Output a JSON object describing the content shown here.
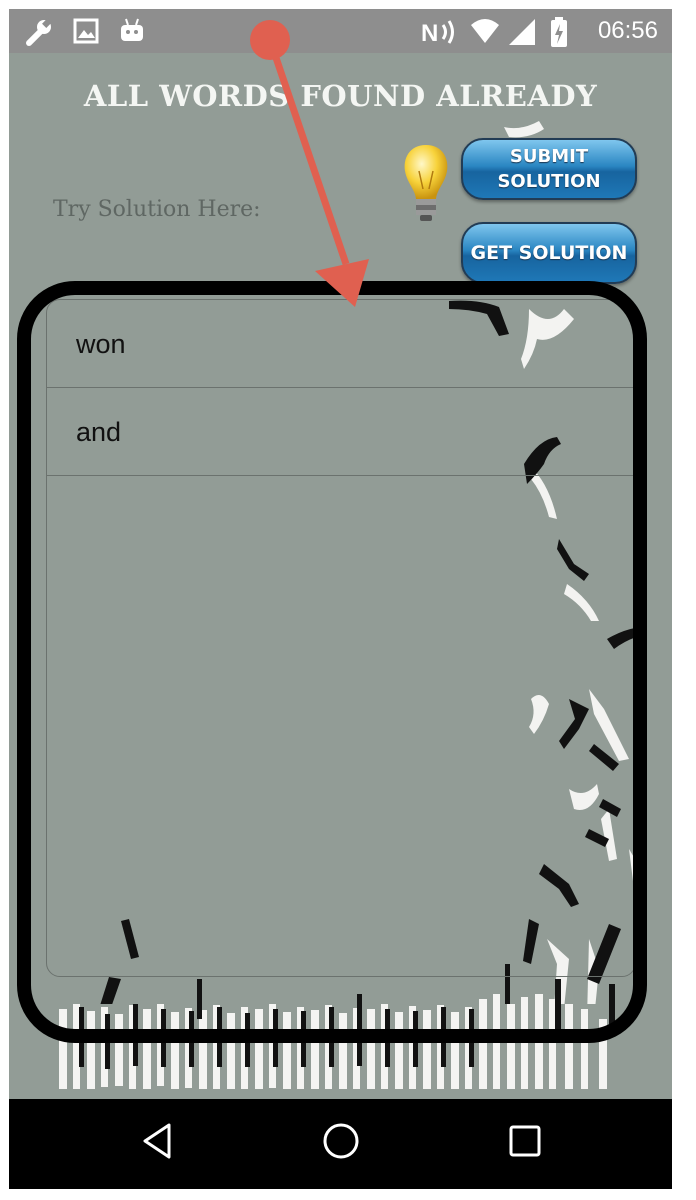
{
  "status_bar": {
    "time": "06:56",
    "left_icons": [
      "wrench-icon",
      "image-icon",
      "android-icon"
    ],
    "right_icons": [
      "nfc-icon",
      "wifi-icon",
      "signal-icon",
      "battery-charging-icon"
    ]
  },
  "header": {
    "title": "ALL WORDS FOUND ALREADY"
  },
  "solution": {
    "label": "Try Solution Here:",
    "submit_label_line1": "SUBMIT",
    "submit_label_line2": "SOLUTION",
    "get_solution_label": "GET SOLUTION",
    "hint_icon": "lightbulb-icon"
  },
  "found_words": [
    "won",
    "and"
  ],
  "annotation": {
    "arrow_color": "#e06050",
    "highlight_color": "#000000"
  },
  "nav_bar": {
    "icons": [
      "back-icon",
      "home-icon",
      "recents-icon"
    ]
  }
}
